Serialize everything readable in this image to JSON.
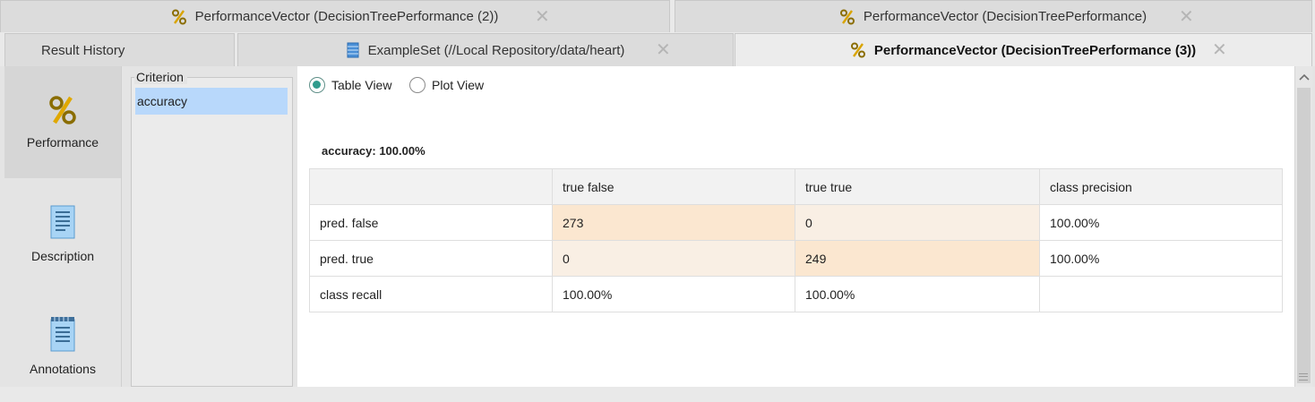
{
  "tabs_row1": [
    {
      "label": "PerformanceVector (DecisionTreePerformance (2))",
      "icon": "percent-icon"
    },
    {
      "label": "PerformanceVector (DecisionTreePerformance)",
      "icon": "percent-icon"
    }
  ],
  "tabs_row2": [
    {
      "label": "Result History"
    },
    {
      "label": "ExampleSet (//Local Repository/data/heart)",
      "icon": "table-icon"
    },
    {
      "label": "PerformanceVector (DecisionTreePerformance (3))",
      "icon": "percent-icon",
      "active": true
    }
  ],
  "close_glyph": "✕",
  "left_nav": [
    {
      "label": "Performance",
      "icon": "percent-icon",
      "selected": true
    },
    {
      "label": "Description",
      "icon": "document-icon"
    },
    {
      "label": "Annotations",
      "icon": "notepad-icon"
    }
  ],
  "criterion": {
    "title": "Criterion",
    "items": [
      "accuracy"
    ],
    "selected": "accuracy"
  },
  "view_options": {
    "table": "Table View",
    "plot": "Plot View",
    "selected": "Table View"
  },
  "result": {
    "title": "accuracy: 100.00%",
    "headers": [
      "",
      "true false",
      "true true",
      "class precision"
    ],
    "rows": [
      [
        "pred. false",
        "273",
        "0",
        "100.00%"
      ],
      [
        "pred. true",
        "0",
        "249",
        "100.00%"
      ],
      [
        "class recall",
        "100.00%",
        "100.00%",
        ""
      ]
    ]
  },
  "colors": {
    "accent": "#2f9b8c",
    "selection": "#b8d8fb",
    "cell_high": "#fbe7d0",
    "cell_low": "#f9efe4"
  }
}
